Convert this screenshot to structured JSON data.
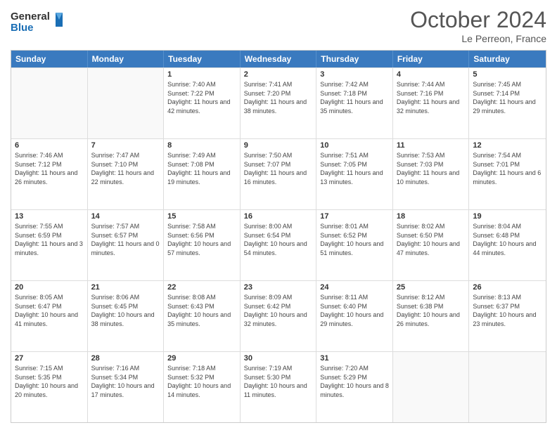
{
  "header": {
    "logo_line1": "General",
    "logo_line2": "Blue",
    "month_title": "October 2024",
    "location": "Le Perreon, France"
  },
  "weekdays": [
    "Sunday",
    "Monday",
    "Tuesday",
    "Wednesday",
    "Thursday",
    "Friday",
    "Saturday"
  ],
  "rows": [
    [
      {
        "day": "",
        "sunrise": "",
        "sunset": "",
        "daylight": ""
      },
      {
        "day": "",
        "sunrise": "",
        "sunset": "",
        "daylight": ""
      },
      {
        "day": "1",
        "sunrise": "Sunrise: 7:40 AM",
        "sunset": "Sunset: 7:22 PM",
        "daylight": "Daylight: 11 hours and 42 minutes."
      },
      {
        "day": "2",
        "sunrise": "Sunrise: 7:41 AM",
        "sunset": "Sunset: 7:20 PM",
        "daylight": "Daylight: 11 hours and 38 minutes."
      },
      {
        "day": "3",
        "sunrise": "Sunrise: 7:42 AM",
        "sunset": "Sunset: 7:18 PM",
        "daylight": "Daylight: 11 hours and 35 minutes."
      },
      {
        "day": "4",
        "sunrise": "Sunrise: 7:44 AM",
        "sunset": "Sunset: 7:16 PM",
        "daylight": "Daylight: 11 hours and 32 minutes."
      },
      {
        "day": "5",
        "sunrise": "Sunrise: 7:45 AM",
        "sunset": "Sunset: 7:14 PM",
        "daylight": "Daylight: 11 hours and 29 minutes."
      }
    ],
    [
      {
        "day": "6",
        "sunrise": "Sunrise: 7:46 AM",
        "sunset": "Sunset: 7:12 PM",
        "daylight": "Daylight: 11 hours and 26 minutes."
      },
      {
        "day": "7",
        "sunrise": "Sunrise: 7:47 AM",
        "sunset": "Sunset: 7:10 PM",
        "daylight": "Daylight: 11 hours and 22 minutes."
      },
      {
        "day": "8",
        "sunrise": "Sunrise: 7:49 AM",
        "sunset": "Sunset: 7:08 PM",
        "daylight": "Daylight: 11 hours and 19 minutes."
      },
      {
        "day": "9",
        "sunrise": "Sunrise: 7:50 AM",
        "sunset": "Sunset: 7:07 PM",
        "daylight": "Daylight: 11 hours and 16 minutes."
      },
      {
        "day": "10",
        "sunrise": "Sunrise: 7:51 AM",
        "sunset": "Sunset: 7:05 PM",
        "daylight": "Daylight: 11 hours and 13 minutes."
      },
      {
        "day": "11",
        "sunrise": "Sunrise: 7:53 AM",
        "sunset": "Sunset: 7:03 PM",
        "daylight": "Daylight: 11 hours and 10 minutes."
      },
      {
        "day": "12",
        "sunrise": "Sunrise: 7:54 AM",
        "sunset": "Sunset: 7:01 PM",
        "daylight": "Daylight: 11 hours and 6 minutes."
      }
    ],
    [
      {
        "day": "13",
        "sunrise": "Sunrise: 7:55 AM",
        "sunset": "Sunset: 6:59 PM",
        "daylight": "Daylight: 11 hours and 3 minutes."
      },
      {
        "day": "14",
        "sunrise": "Sunrise: 7:57 AM",
        "sunset": "Sunset: 6:57 PM",
        "daylight": "Daylight: 11 hours and 0 minutes."
      },
      {
        "day": "15",
        "sunrise": "Sunrise: 7:58 AM",
        "sunset": "Sunset: 6:56 PM",
        "daylight": "Daylight: 10 hours and 57 minutes."
      },
      {
        "day": "16",
        "sunrise": "Sunrise: 8:00 AM",
        "sunset": "Sunset: 6:54 PM",
        "daylight": "Daylight: 10 hours and 54 minutes."
      },
      {
        "day": "17",
        "sunrise": "Sunrise: 8:01 AM",
        "sunset": "Sunset: 6:52 PM",
        "daylight": "Daylight: 10 hours and 51 minutes."
      },
      {
        "day": "18",
        "sunrise": "Sunrise: 8:02 AM",
        "sunset": "Sunset: 6:50 PM",
        "daylight": "Daylight: 10 hours and 47 minutes."
      },
      {
        "day": "19",
        "sunrise": "Sunrise: 8:04 AM",
        "sunset": "Sunset: 6:48 PM",
        "daylight": "Daylight: 10 hours and 44 minutes."
      }
    ],
    [
      {
        "day": "20",
        "sunrise": "Sunrise: 8:05 AM",
        "sunset": "Sunset: 6:47 PM",
        "daylight": "Daylight: 10 hours and 41 minutes."
      },
      {
        "day": "21",
        "sunrise": "Sunrise: 8:06 AM",
        "sunset": "Sunset: 6:45 PM",
        "daylight": "Daylight: 10 hours and 38 minutes."
      },
      {
        "day": "22",
        "sunrise": "Sunrise: 8:08 AM",
        "sunset": "Sunset: 6:43 PM",
        "daylight": "Daylight: 10 hours and 35 minutes."
      },
      {
        "day": "23",
        "sunrise": "Sunrise: 8:09 AM",
        "sunset": "Sunset: 6:42 PM",
        "daylight": "Daylight: 10 hours and 32 minutes."
      },
      {
        "day": "24",
        "sunrise": "Sunrise: 8:11 AM",
        "sunset": "Sunset: 6:40 PM",
        "daylight": "Daylight: 10 hours and 29 minutes."
      },
      {
        "day": "25",
        "sunrise": "Sunrise: 8:12 AM",
        "sunset": "Sunset: 6:38 PM",
        "daylight": "Daylight: 10 hours and 26 minutes."
      },
      {
        "day": "26",
        "sunrise": "Sunrise: 8:13 AM",
        "sunset": "Sunset: 6:37 PM",
        "daylight": "Daylight: 10 hours and 23 minutes."
      }
    ],
    [
      {
        "day": "27",
        "sunrise": "Sunrise: 7:15 AM",
        "sunset": "Sunset: 5:35 PM",
        "daylight": "Daylight: 10 hours and 20 minutes."
      },
      {
        "day": "28",
        "sunrise": "Sunrise: 7:16 AM",
        "sunset": "Sunset: 5:34 PM",
        "daylight": "Daylight: 10 hours and 17 minutes."
      },
      {
        "day": "29",
        "sunrise": "Sunrise: 7:18 AM",
        "sunset": "Sunset: 5:32 PM",
        "daylight": "Daylight: 10 hours and 14 minutes."
      },
      {
        "day": "30",
        "sunrise": "Sunrise: 7:19 AM",
        "sunset": "Sunset: 5:30 PM",
        "daylight": "Daylight: 10 hours and 11 minutes."
      },
      {
        "day": "31",
        "sunrise": "Sunrise: 7:20 AM",
        "sunset": "Sunset: 5:29 PM",
        "daylight": "Daylight: 10 hours and 8 minutes."
      },
      {
        "day": "",
        "sunrise": "",
        "sunset": "",
        "daylight": ""
      },
      {
        "day": "",
        "sunrise": "",
        "sunset": "",
        "daylight": ""
      }
    ]
  ]
}
